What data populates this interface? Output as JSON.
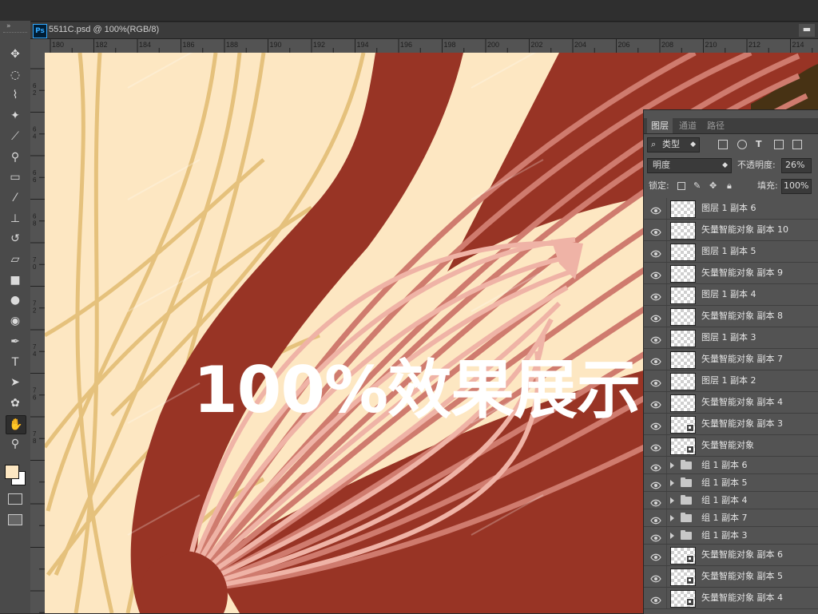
{
  "document": {
    "title": "5511C.psd @ 100%(RGB/8)",
    "app_badge": "Ps",
    "minimize_label": "▬"
  },
  "ruler": {
    "h_ticks": [
      "180",
      "182",
      "184",
      "186",
      "188",
      "190",
      "192",
      "194",
      "196",
      "198",
      "200",
      "202",
      "204",
      "206",
      "208",
      "210",
      "212",
      "214"
    ],
    "v_ticks": [
      "6 2",
      "6 4",
      "6 6",
      "6 8",
      "7 0",
      "7 2",
      "7 4",
      "7 6",
      "7 8"
    ]
  },
  "toolbar": {
    "collapse_label": "»",
    "tools": [
      {
        "name": "move-tool",
        "icon": "move-icon"
      },
      {
        "name": "marquee-tool",
        "icon": "ellipse-marquee-icon"
      },
      {
        "name": "lasso-tool",
        "icon": "polygon-lasso-icon"
      },
      {
        "name": "magic-wand-tool",
        "icon": "magic-wand-icon"
      },
      {
        "name": "crop-tool",
        "icon": "slice-icon"
      },
      {
        "name": "eyedropper-tool",
        "icon": "eyedropper-icon"
      },
      {
        "name": "healing-tool",
        "icon": "bandage-icon"
      },
      {
        "name": "brush-tool",
        "icon": "brush-icon"
      },
      {
        "name": "stamp-tool",
        "icon": "stamp-icon"
      },
      {
        "name": "history-brush-tool",
        "icon": "history-brush-icon"
      },
      {
        "name": "eraser-tool",
        "icon": "eraser-icon"
      },
      {
        "name": "gradient-tool",
        "icon": "gradient-icon"
      },
      {
        "name": "blur-tool",
        "icon": "drop-icon"
      },
      {
        "name": "dodge-tool",
        "icon": "dodge-icon"
      },
      {
        "name": "pen-tool",
        "icon": "pen-icon"
      },
      {
        "name": "type-tool",
        "icon": "type-icon"
      },
      {
        "name": "path-selection-tool",
        "icon": "arrow-select-icon"
      },
      {
        "name": "shape-tool",
        "icon": "custom-shape-icon"
      },
      {
        "name": "hand-tool",
        "icon": "hand-icon"
      },
      {
        "name": "zoom-tool",
        "icon": "magnifier-icon"
      }
    ],
    "foreground_color": "#fde7c2",
    "background_color": "#ffffff"
  },
  "overlay_text": "100%效果展示",
  "panel": {
    "tabs": [
      "图层",
      "通道",
      "路径"
    ],
    "filter_kind": "类型",
    "blend_mode": "明度",
    "opacity_label": "不透明度:",
    "opacity_value": "26%",
    "lock_label": "锁定:",
    "fill_label": "填充:",
    "fill_value": "100%",
    "layers": [
      {
        "name": "图层 1 副本 6",
        "kind": "raster"
      },
      {
        "name": "矢量智能对象 副本 10",
        "kind": "raster"
      },
      {
        "name": "图层 1 副本 5",
        "kind": "raster"
      },
      {
        "name": "矢量智能对象 副本 9",
        "kind": "raster"
      },
      {
        "name": "图层 1 副本 4",
        "kind": "raster"
      },
      {
        "name": "矢量智能对象 副本 8",
        "kind": "raster"
      },
      {
        "name": "图层 1 副本 3",
        "kind": "raster"
      },
      {
        "name": "矢量智能对象 副本 7",
        "kind": "raster"
      },
      {
        "name": "图层 1 副本 2",
        "kind": "raster"
      },
      {
        "name": "矢量智能对象 副本 4",
        "kind": "raster"
      },
      {
        "name": "矢量智能对象 副本 3",
        "kind": "smart"
      },
      {
        "name": "矢量智能对象",
        "kind": "smart"
      },
      {
        "name": "组 1 副本 6",
        "kind": "group"
      },
      {
        "name": "组 1 副本 5",
        "kind": "group"
      },
      {
        "name": "组 1 副本 4",
        "kind": "group"
      },
      {
        "name": "组 1 副本 7",
        "kind": "group"
      },
      {
        "name": "组 1 副本 3",
        "kind": "group"
      },
      {
        "name": "矢量智能对象 副本 6",
        "kind": "smart"
      },
      {
        "name": "矢量智能对象 副本 5",
        "kind": "smart"
      },
      {
        "name": "矢量智能对象 副本 4",
        "kind": "smart"
      }
    ]
  },
  "colors": {
    "canvas_bg": "#fde7c2",
    "dark_red": "#983425",
    "salmon": "#cf7b6e",
    "light_pink": "#efb3a6",
    "gold_line": "#e5c17c",
    "dark_brown": "#473214"
  }
}
